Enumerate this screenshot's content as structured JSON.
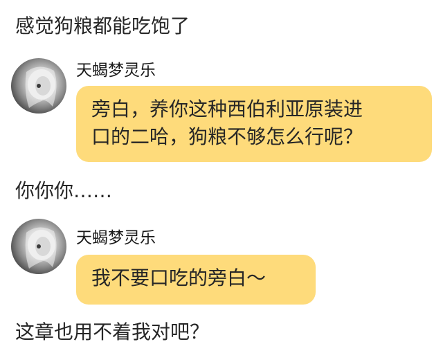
{
  "lines": {
    "line1": "感觉狗粮都能吃饱了",
    "line2": "你你你……",
    "line3": "这章也用不着我对吧？"
  },
  "messages": [
    {
      "sender": "天蝎梦灵乐",
      "text_line1": "旁白，养你这种西伯利亚原装进",
      "text_line2": "口的二哈，狗粮不够怎么行呢？"
    },
    {
      "sender": "天蝎梦灵乐",
      "text": "我不要口吃的旁白～"
    }
  ],
  "colors": {
    "bubble": "#fedb7b",
    "text": "#262626"
  },
  "icons": {
    "avatar": "avatar-image"
  }
}
